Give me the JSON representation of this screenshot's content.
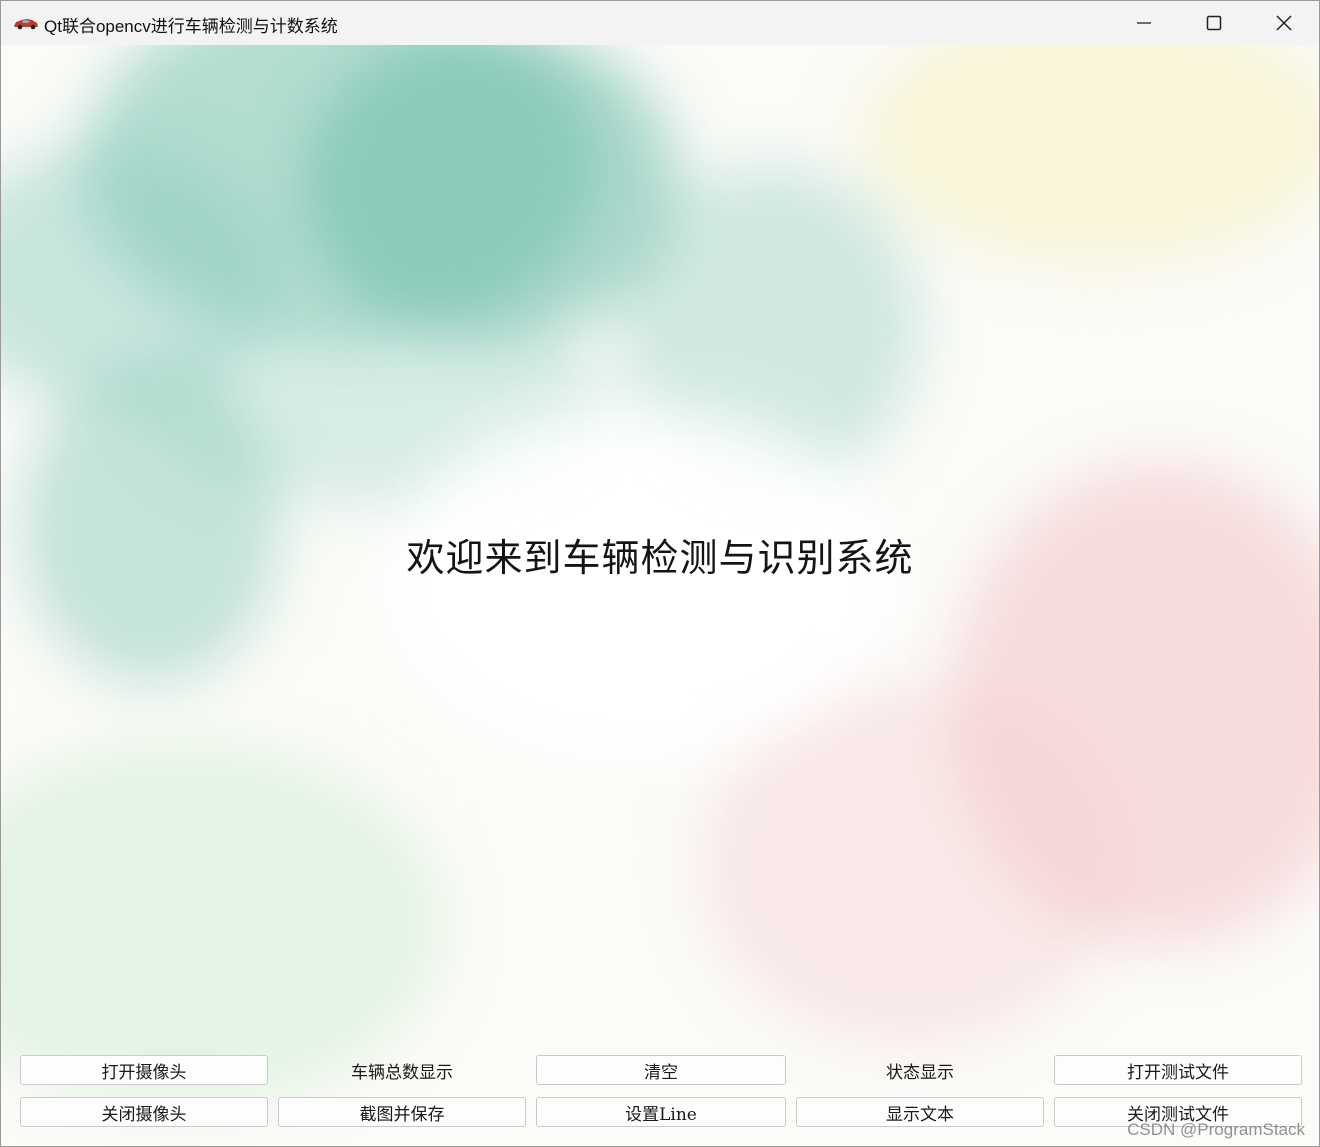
{
  "window": {
    "title": "Qt联合opencv进行车辆检测与计数系统",
    "icon": "red-car-icon",
    "controls": [
      "minimize-icon",
      "maximize-icon",
      "close-icon"
    ]
  },
  "main": {
    "welcome_text": "欢迎来到车辆检测与识别系统"
  },
  "controls": {
    "open_camera": "打开摄像头",
    "total_count_label": "车辆总数显示",
    "clear": "清空",
    "status_label": "状态显示",
    "open_test_file": "打开测试文件",
    "close_camera": "关闭摄像头",
    "screenshot_save": "截图并保存",
    "set_line": "设置Line",
    "show_text": "显示文本",
    "close_test_file": "关闭测试文件"
  },
  "watermark": "CSDN @ProgramStack",
  "colors": {
    "titlebar": "#f3f3f3",
    "watercolor_teal": "#8ccdbd",
    "watercolor_pink": "#f3c4c8",
    "watercolor_yellow": "#f7f3d2",
    "app_icon": "#c0392b"
  }
}
